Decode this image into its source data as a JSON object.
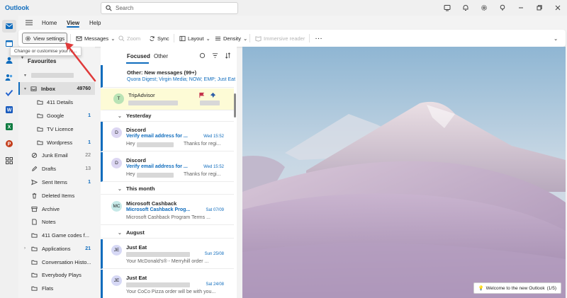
{
  "app": {
    "title": "Outlook"
  },
  "search": {
    "placeholder": "Search"
  },
  "ribbon": {
    "tabs": [
      "Home",
      "View",
      "Help"
    ],
    "active_tab": "View"
  },
  "toolbar": {
    "view_settings": "View settings",
    "messages": "Messages",
    "zoom": "Zoom",
    "sync": "Sync",
    "layout": "Layout",
    "density": "Density",
    "immersive_reader": "Immersive reader"
  },
  "tooltip": "Change or customise your m...",
  "folders": {
    "favourites": "Favourites",
    "items": [
      {
        "name": "Inbox",
        "count": "49760"
      },
      {
        "name": "411 Details",
        "count": ""
      },
      {
        "name": "Google",
        "count": "1"
      },
      {
        "name": "TV Licence",
        "count": ""
      },
      {
        "name": "Wordpress",
        "count": "1"
      },
      {
        "name": "Junk Email",
        "count": "22"
      },
      {
        "name": "Drafts",
        "count": "13"
      },
      {
        "name": "Sent Items",
        "count": "1"
      },
      {
        "name": "Deleted Items",
        "count": ""
      },
      {
        "name": "Archive",
        "count": ""
      },
      {
        "name": "Notes",
        "count": ""
      },
      {
        "name": "411 Game codes f...",
        "count": ""
      },
      {
        "name": "Applications",
        "count": "21"
      },
      {
        "name": "Conversation Histo...",
        "count": ""
      },
      {
        "name": "Everybody Plays",
        "count": ""
      },
      {
        "name": "Flats",
        "count": ""
      }
    ]
  },
  "message_list": {
    "tabs": {
      "focused": "Focused",
      "other": "Other"
    },
    "other_banner": {
      "title": "Other: New messages (99+)",
      "senders": "Quora Digest; Virgin Media; NOW; EMP; Just Eat"
    },
    "groups": {
      "yesterday": "Yesterday",
      "this_month": "This month",
      "august": "August"
    },
    "messages": [
      {
        "initials": "T",
        "sender": "TripAdvisor",
        "subject": "",
        "preview": "",
        "date": ""
      },
      {
        "initials": "D",
        "sender": "Discord",
        "subject": "Verify email address for ...",
        "preview": "Hey",
        "preview2": "Thanks for regi...",
        "date": "Wed 15:52"
      },
      {
        "initials": "D",
        "sender": "Discord",
        "subject": "Verify email address for ...",
        "preview": "Hey",
        "preview2": "Thanks for regi...",
        "date": "Wed 15:52"
      },
      {
        "initials": "MC",
        "sender": "Microsoft Cashback",
        "subject": "Microsoft Cashback Prog...",
        "preview": "Microsoft Cashback Program Terms ...",
        "date": "Sat 07/09"
      },
      {
        "initials": "JE",
        "sender": "Just Eat",
        "subject": "",
        "preview": "Your McDonald's® - Merryhill order ...",
        "date": "Sun 25/08"
      },
      {
        "initials": "JE",
        "sender": "Just Eat",
        "subject": "",
        "preview": "Your CoCo Pizza order will be with you...",
        "date": "Sat 24/08"
      }
    ]
  },
  "reading_pane": {
    "welcome": "Welcome to the new Outlook",
    "welcome_page": "(1/5)"
  },
  "colors": {
    "accent": "#0f6cbd",
    "arrow": "#e03a3a",
    "flag": "#c4314b"
  }
}
